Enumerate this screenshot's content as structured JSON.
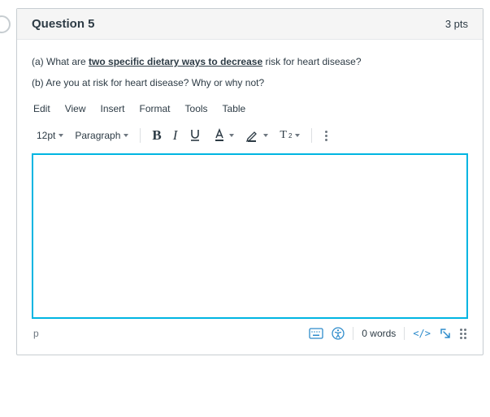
{
  "header": {
    "title": "Question 5",
    "points": "3 pts"
  },
  "prompt": {
    "a_prefix": "(a) What are ",
    "a_underlined": "two specific dietary ways to decrease",
    "a_suffix": " risk for heart disease?",
    "b": "(b) Are you at risk for heart disease? Why or why not?"
  },
  "menubar": [
    "Edit",
    "View",
    "Insert",
    "Format",
    "Tools",
    "Table"
  ],
  "toolbar": {
    "font_size": "12pt",
    "paragraph": "Paragraph",
    "bold": "B",
    "italic": "I",
    "superscript": "T",
    "super_exp": "2"
  },
  "footer": {
    "path": "p",
    "words": "0 words",
    "code": "</>"
  }
}
